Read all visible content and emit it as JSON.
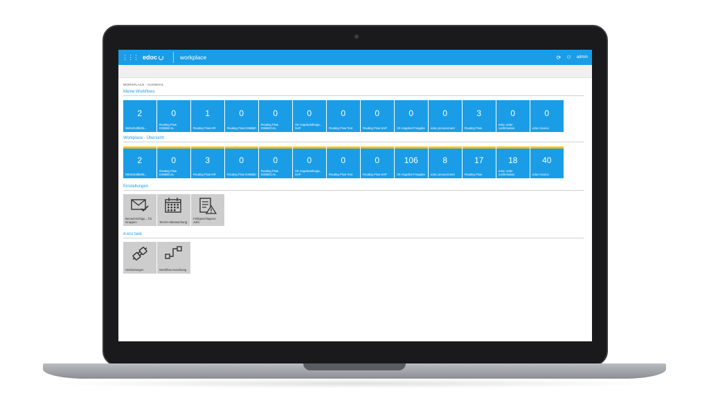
{
  "header": {
    "apps_glyph": "⋮⋮⋮",
    "brand": "edoc",
    "app_title": "workplace",
    "user": "admin"
  },
  "breadcrumb": "WORKPLACE - AUSWAHL",
  "meine_workflows": {
    "title": "Meine Workflows",
    "tiles": [
      {
        "count": "2",
        "label": "Wirtschaftlichk..."
      },
      {
        "count": "0",
        "label": "Routing Flow D365BCAL"
      },
      {
        "count": "1",
        "label": "Routing Flow HR"
      },
      {
        "count": "0",
        "label": "Routing Flow D365BC"
      },
      {
        "count": "0",
        "label": "Routing Flow D365DCAL"
      },
      {
        "count": "0",
        "label": "VK Angebotsfreiga... SAP"
      },
      {
        "count": "0",
        "label": "Routing Flow Test"
      },
      {
        "count": "0",
        "label": "Routing Flow SAP"
      },
      {
        "count": "0",
        "label": "VK Angebot Freigabe"
      },
      {
        "count": "0",
        "label": "edoc procurement"
      },
      {
        "count": "3",
        "label": "Routing Flow"
      },
      {
        "count": "0",
        "label": "edoc order confirmation"
      },
      {
        "count": "0",
        "label": "edoc invoice"
      }
    ]
  },
  "workplace_uebersicht": {
    "title": "Workplace - Übersicht",
    "tiles": [
      {
        "count": "2",
        "label": "Wirtschaftlichk..."
      },
      {
        "count": "0",
        "label": "Routing Flow D365BCAL"
      },
      {
        "count": "3",
        "label": "Routing Flow HR"
      },
      {
        "count": "0",
        "label": "Routing Flow D365BC"
      },
      {
        "count": "0",
        "label": "Routing Flow D365DCAL"
      },
      {
        "count": "0",
        "label": "VK Angebotsfreiga... SAP"
      },
      {
        "count": "0",
        "label": "Routing Flow Test"
      },
      {
        "count": "0",
        "label": "Routing Flow SAP"
      },
      {
        "count": "106",
        "label": "VK Angebot Freigabe"
      },
      {
        "count": "8",
        "label": "edoc procurement"
      },
      {
        "count": "17",
        "label": "Routing Flow"
      },
      {
        "count": "18",
        "label": "edoc order confirmation"
      },
      {
        "count": "40",
        "label": "edoc invoice"
      }
    ]
  },
  "einstellungen": {
    "title": "Einstellungen",
    "tiles": [
      {
        "label": "Benachrichtigu... für Gruppen",
        "icon": "mail-check-icon"
      },
      {
        "label": "Termin-überwachung",
        "icon": "calendar-icon"
      },
      {
        "label": "Fehlgeschlagene Jobs",
        "icon": "failed-jobs-icon"
      }
    ]
  },
  "decs_task": {
    "title": "d.ecs task",
    "tiles": [
      {
        "label": "Verbindungen",
        "icon": "plug-icon"
      },
      {
        "label": "Workflow-zuordnung",
        "icon": "workflow-icon"
      }
    ]
  },
  "colors": {
    "accent": "#1a9de6",
    "highlight": "#ffc000",
    "settings_tile": "#cdcdcd"
  }
}
